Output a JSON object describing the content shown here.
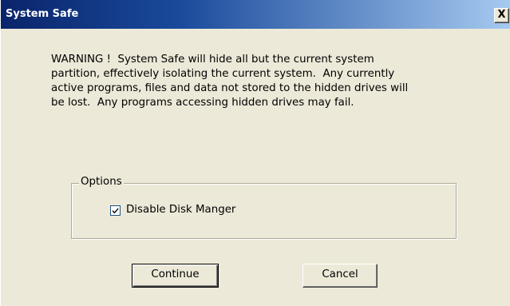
{
  "window": {
    "title": "System Safe",
    "close_label": "X"
  },
  "message": {
    "warning_text": "WARNING !  System Safe will hide all but the current system\npartition, effectively isolating the current system.  Any currently\nactive programs, files and data not stored to the hidden drives will\nbe lost.  Any programs accessing hidden drives may fail."
  },
  "options": {
    "group_label": "Options",
    "disable_disk_manager": {
      "label": "Disable Disk Manger",
      "checked": true
    }
  },
  "buttons": {
    "continue_label": "Continue",
    "cancel_label": "Cancel"
  },
  "colors": {
    "dialog_background": "#ece9d8",
    "titlebar_start": "#0a246a",
    "titlebar_end": "#a6caf0",
    "title_text": "#ffffff"
  },
  "icons": {
    "close": "close-icon",
    "check": "checkmark-icon"
  }
}
